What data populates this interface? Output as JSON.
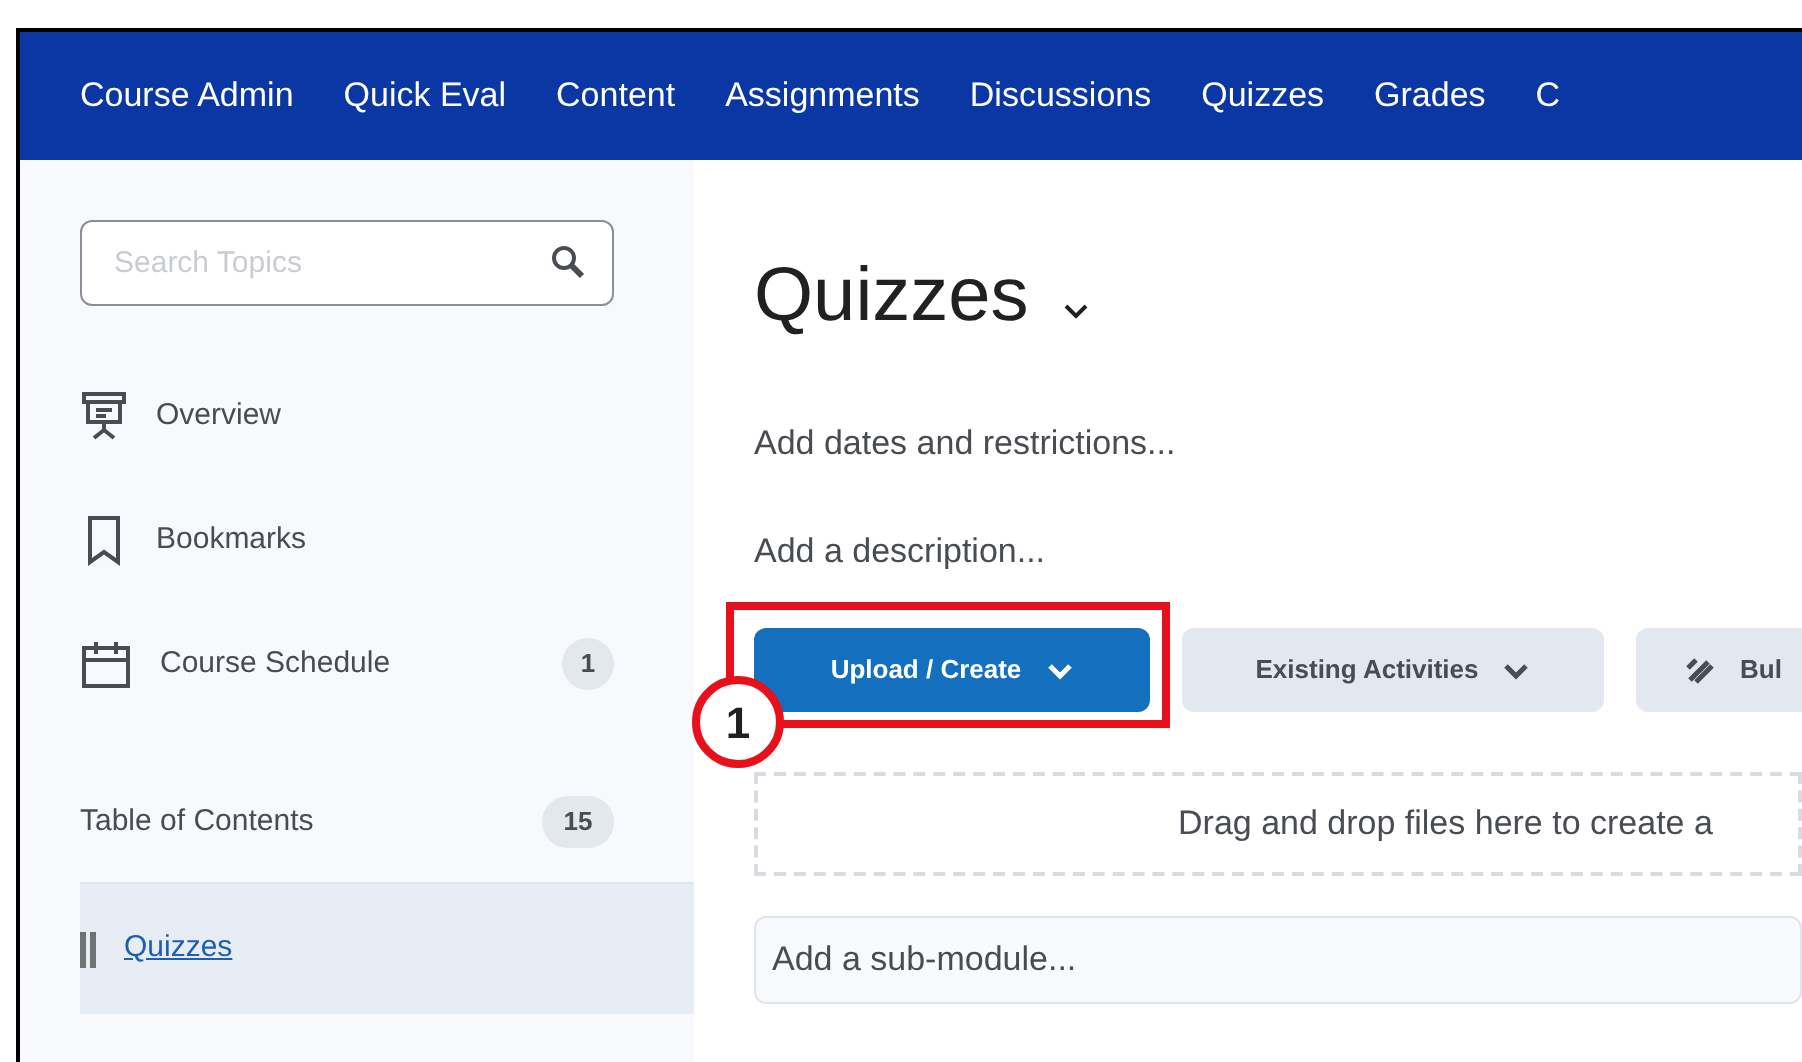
{
  "nav": {
    "items": [
      {
        "label": "Course Admin"
      },
      {
        "label": "Quick Eval"
      },
      {
        "label": "Content"
      },
      {
        "label": "Assignments"
      },
      {
        "label": "Discussions"
      },
      {
        "label": "Quizzes"
      },
      {
        "label": "Grades"
      },
      {
        "label": "C"
      }
    ]
  },
  "sidebar": {
    "search": {
      "placeholder": "Search Topics"
    },
    "items": [
      {
        "kind": "overview",
        "label": "Overview"
      },
      {
        "kind": "bookmarks",
        "label": "Bookmarks"
      },
      {
        "kind": "schedule",
        "label": "Course Schedule",
        "count": "1"
      }
    ],
    "toc": {
      "label": "Table of Contents",
      "count": "15"
    },
    "modules": [
      {
        "label": "Quizzes",
        "selected": true
      }
    ]
  },
  "main": {
    "title": "Quizzes",
    "links": [
      "Add dates and restrictions...",
      "Add a description..."
    ],
    "buttons": [
      {
        "kind": "dropdown",
        "label": "Upload / Create",
        "primary": true,
        "highlighted": true,
        "callout": "1"
      },
      {
        "kind": "dropdown",
        "label": "Existing Activities",
        "primary": false,
        "highlighted": false
      },
      {
        "kind": "tool",
        "label": "Bul",
        "primary": false,
        "highlighted": false
      }
    ],
    "dropzone": "Drag and drop files here to create a",
    "submodule": {
      "placeholder": "Add a sub-module..."
    }
  }
}
